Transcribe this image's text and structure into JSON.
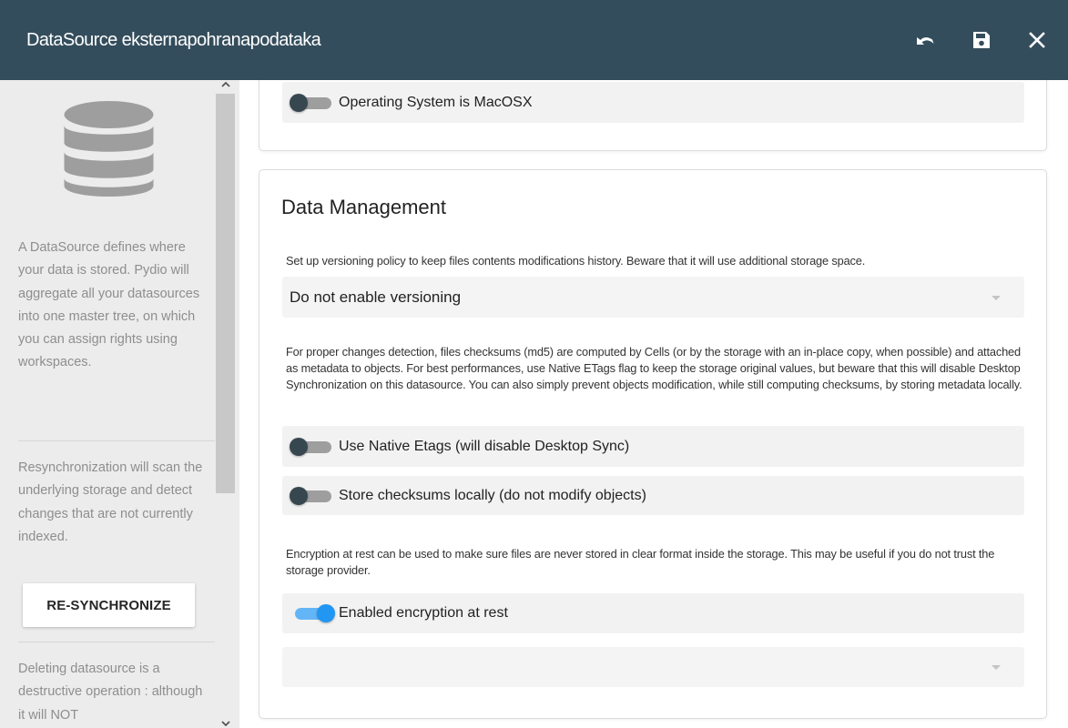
{
  "header": {
    "title": "DataSource eksternapohranapodataka",
    "undo_icon": "undo-icon",
    "save_icon": "save-icon",
    "close_icon": "close-icon"
  },
  "sidebar": {
    "icon": "database-icon",
    "description": "A DataSource defines where your data is stored. Pydio will aggregate all your datasources into one master tree, on which you can assign rights using workspaces.",
    "resync_text": "Resynchronization will scan the underlying storage and detect changes that are not currently indexed.",
    "resync_button": "RE-SYNCHRONIZE",
    "delete_text": "Deleting datasource is a destructive operation : although it will NOT"
  },
  "main": {
    "top_card": {
      "macosx_label": "Operating System is MacOSX",
      "macosx_enabled": false
    },
    "data_management": {
      "title": "Data Management",
      "versioning_desc": "Set up versioning policy to keep files contents modifications history. Beware that it will use additional storage space.",
      "versioning_value": "Do not enable versioning",
      "checksum_desc": "For proper changes detection, files checksums (md5) are computed by Cells (or by the storage with an in-place copy, when possible) and attached as metadata to objects. For best performances, use Native ETags flag to keep the storage original values, but beware that this will disable Desktop Synchronization on this datasource. You can also simply prevent objects modification, while still computing checksums, by storing metadata locally.",
      "native_etags_label": "Use Native Etags (will disable Desktop Sync)",
      "native_etags_enabled": false,
      "store_checksums_label": "Store checksums locally (do not modify objects)",
      "store_checksums_enabled": false,
      "encryption_desc": "Encryption at rest can be used to make sure files are never stored in clear format inside the storage. This may be useful if you do not trust the storage provider.",
      "encryption_label": "Enabled encryption at rest",
      "encryption_enabled": true,
      "encryption_key_value": ""
    }
  }
}
